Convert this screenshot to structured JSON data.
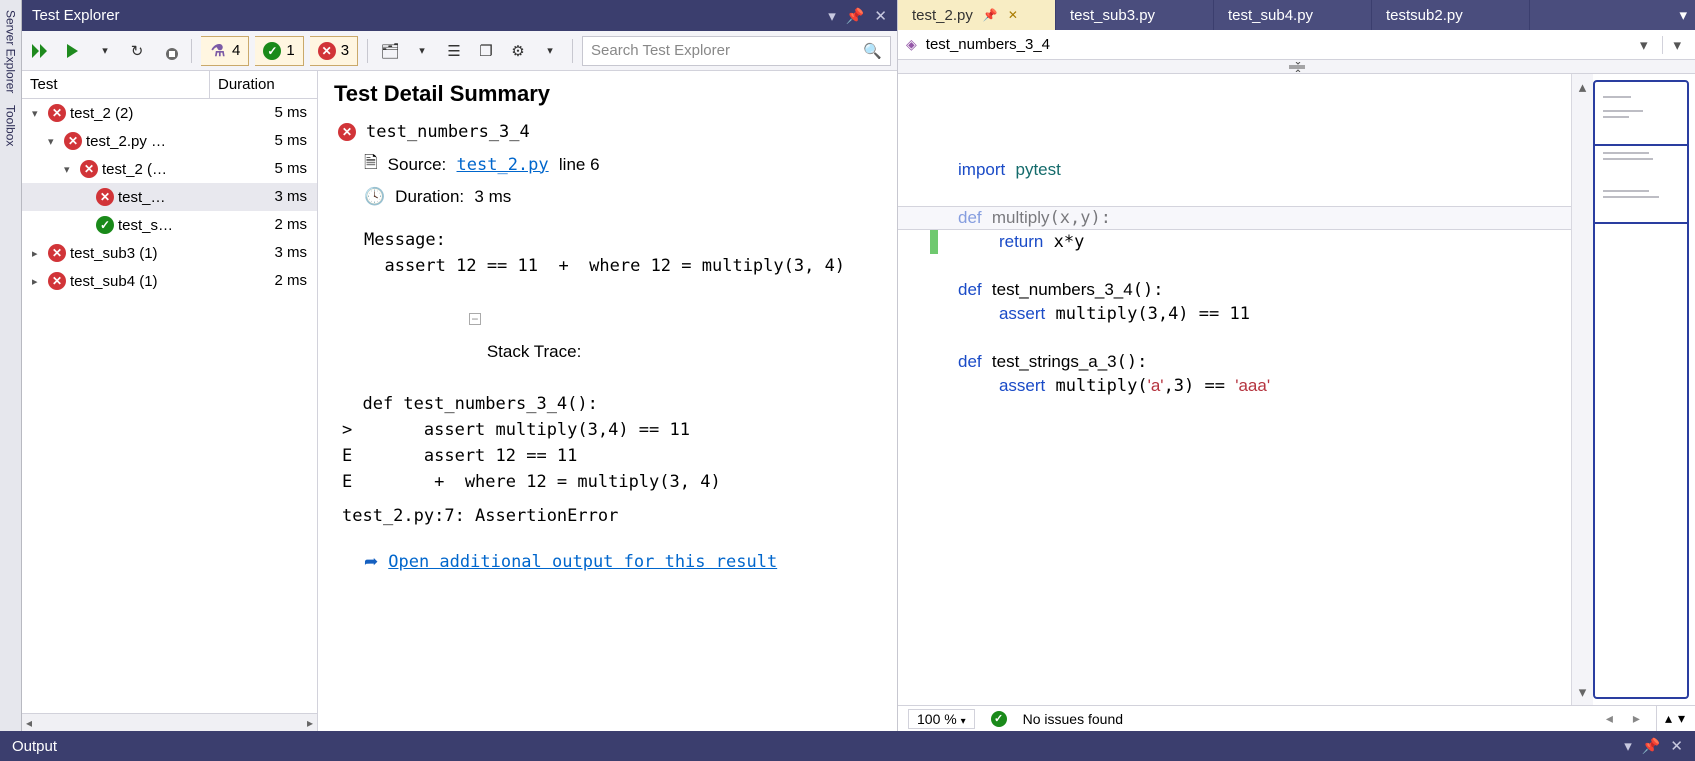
{
  "testExplorer": {
    "title": "Test Explorer",
    "searchPlaceholder": "Search Test Explorer",
    "counts": {
      "flask": "4",
      "pass": "1",
      "fail": "3"
    },
    "columns": {
      "test": "Test",
      "duration": "Duration"
    },
    "rows": [
      {
        "indent": 0,
        "expander": "▾",
        "status": "fail",
        "label": "test_2  (2)",
        "dur": "5 ms"
      },
      {
        "indent": 1,
        "expander": "▾",
        "status": "fail",
        "label": "test_2.py …",
        "dur": "5 ms"
      },
      {
        "indent": 2,
        "expander": "▾",
        "status": "fail",
        "label": "test_2 (…",
        "dur": "5 ms"
      },
      {
        "indent": 3,
        "expander": "",
        "status": "fail",
        "label": "test_…",
        "dur": "3 ms",
        "selected": true
      },
      {
        "indent": 3,
        "expander": "",
        "status": "pass",
        "label": "test_s…",
        "dur": "2 ms"
      },
      {
        "indent": 0,
        "expander": "▸",
        "status": "fail",
        "label": "test_sub3  (1)",
        "dur": "3 ms"
      },
      {
        "indent": 0,
        "expander": "▸",
        "status": "fail",
        "label": "test_sub4  (1)",
        "dur": "2 ms"
      }
    ]
  },
  "detail": {
    "heading": "Test Detail Summary",
    "testName": "test_numbers_3_4",
    "sourceLabel": "Source:",
    "sourceFile": "test_2.py",
    "sourceLine": "line 6",
    "durationLabel": "Duration:",
    "durationValue": "3 ms",
    "messageLabel": "Message:",
    "messageBody": "  assert 12 == 11  +  where 12 = multiply(3, 4)",
    "stackLabel": "Stack Trace:",
    "stackBody": "  def test_numbers_3_4():\n>       assert multiply(3,4) == 11\nE       assert 12 == 11\nE        +  where 12 = multiply(3, 4)",
    "errorLine": "test_2.py:7: AssertionError",
    "openLink": "Open additional output for this result"
  },
  "editor": {
    "tabs": [
      {
        "label": "test_2.py",
        "active": true,
        "pinned": true
      },
      {
        "label": "test_sub3.py"
      },
      {
        "label": "test_sub4.py"
      },
      {
        "label": "testsub2.py"
      }
    ],
    "navItem": "test_numbers_3_4",
    "zoom": "100 %",
    "status": "No issues found"
  },
  "output": {
    "title": "Output"
  }
}
